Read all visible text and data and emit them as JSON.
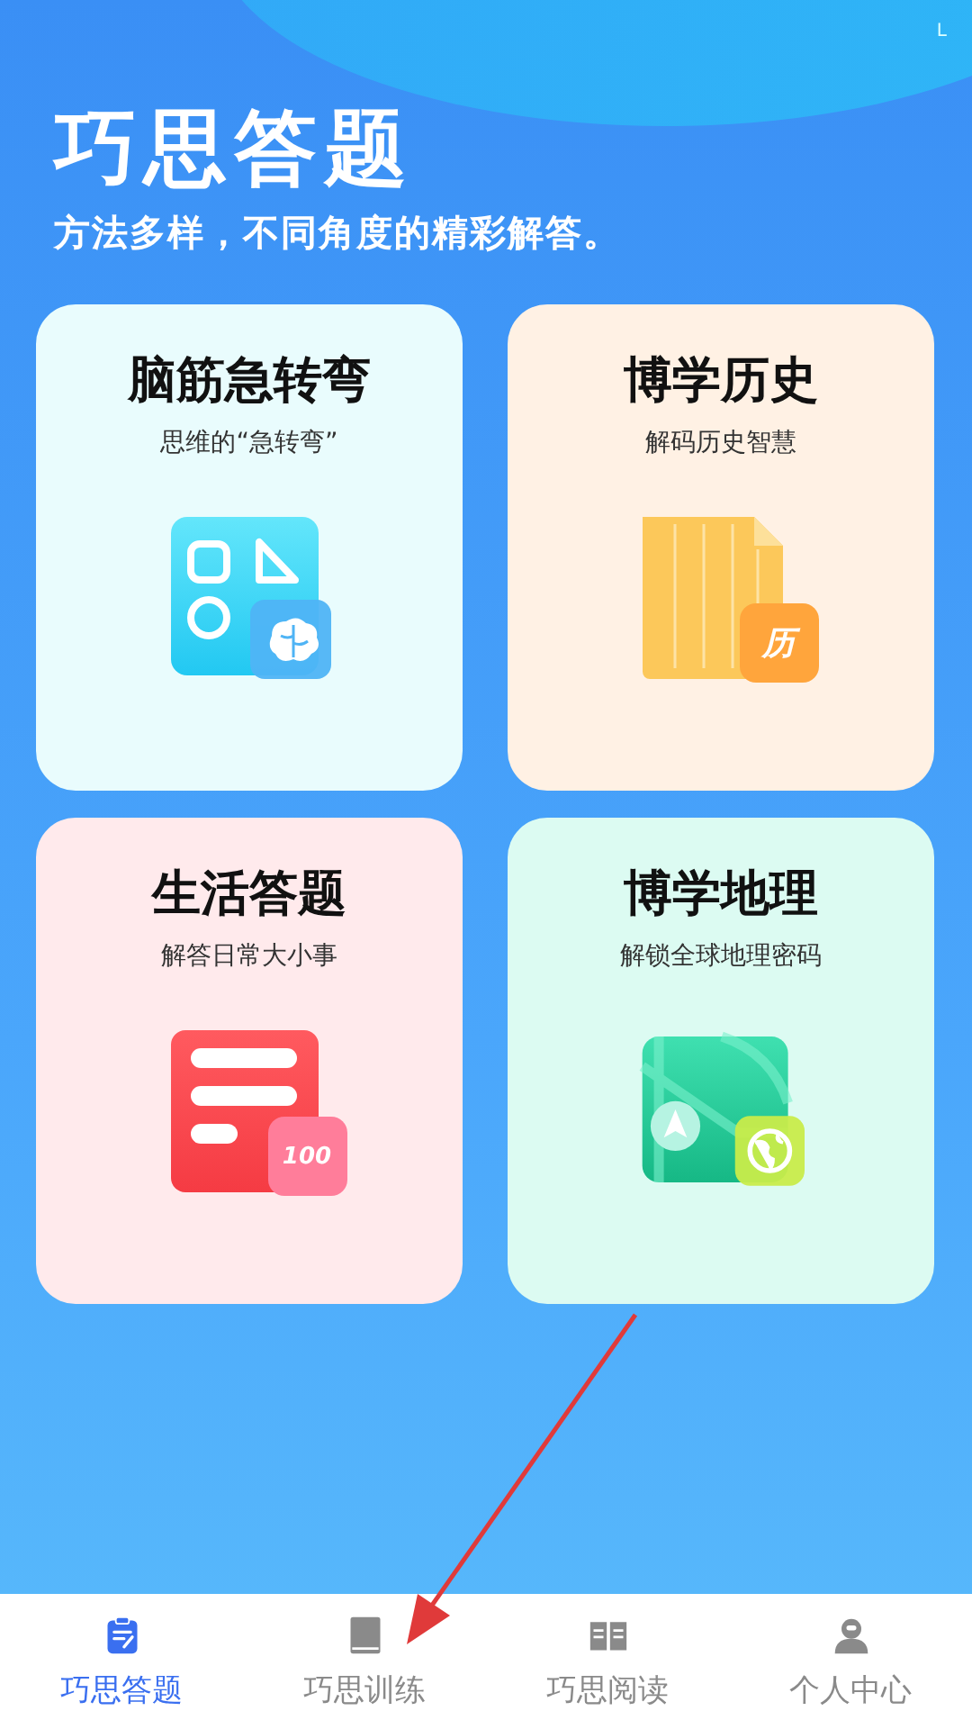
{
  "status_bar": {
    "text": "L"
  },
  "header": {
    "title": "巧思答题",
    "subtitle": "方法多样，不同角度的精彩解答。"
  },
  "cards": [
    {
      "title": "脑筋急转弯",
      "subtitle": "思维的“急转弯”",
      "kind": "shapes"
    },
    {
      "title": "博学历史",
      "subtitle": "解码历史智慧",
      "kind": "book",
      "badge": "历"
    },
    {
      "title": "生活答题",
      "subtitle": "解答日常大小事",
      "kind": "list",
      "badge": "100"
    },
    {
      "title": "博学地理",
      "subtitle": "解锁全球地理密码",
      "kind": "map"
    }
  ],
  "tabs": [
    {
      "label": "巧思答题",
      "selected": true,
      "kind": "clipboard"
    },
    {
      "label": "巧思训练",
      "selected": false,
      "kind": "notebook"
    },
    {
      "label": "巧思阅读",
      "selected": false,
      "kind": "book"
    },
    {
      "label": "个人中心",
      "selected": false,
      "kind": "person"
    }
  ]
}
